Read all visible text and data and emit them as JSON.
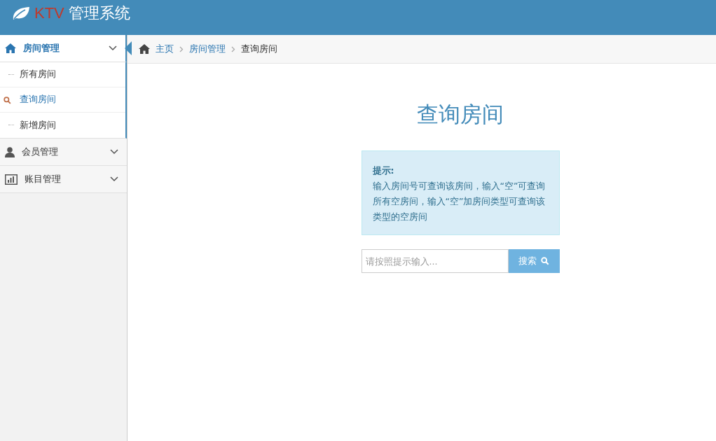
{
  "header": {
    "brand": "KTV",
    "title": "管理系统"
  },
  "sidebar": {
    "groups": [
      {
        "label": "房间管理",
        "kind": "home",
        "expanded": true,
        "children": [
          {
            "label": "所有房间",
            "selected": false
          },
          {
            "label": "查询房间",
            "selected": true
          },
          {
            "label": "新增房间",
            "selected": false
          }
        ]
      },
      {
        "label": "会员管理",
        "kind": "user",
        "expanded": false
      },
      {
        "label": "账目管理",
        "kind": "chart",
        "expanded": false
      }
    ]
  },
  "breadcrumb": [
    {
      "label": "主页",
      "link": true
    },
    {
      "label": "房间管理",
      "link": true
    },
    {
      "label": "查询房间",
      "link": false
    }
  ],
  "main": {
    "title": "查询房间",
    "alert": {
      "heading": "提示:",
      "text": "输入房间号可查询该房间，输入“空”可查询所有空房间，输入“空”加房间类型可查询该类型的空房间"
    },
    "search": {
      "placeholder": "请按照提示输入...",
      "button": "搜索"
    }
  }
}
